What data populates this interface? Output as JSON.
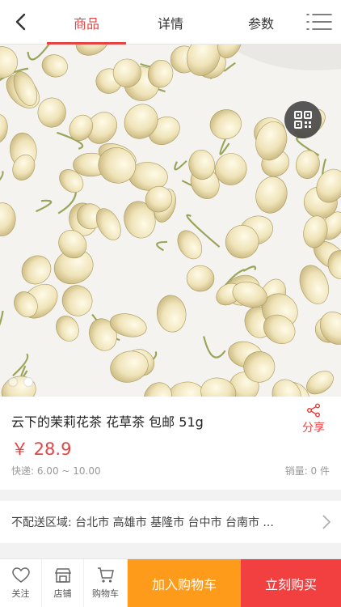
{
  "header": {
    "tabs": [
      {
        "label": "商品",
        "active": true
      },
      {
        "label": "详情",
        "active": false
      },
      {
        "label": "参数",
        "active": false
      }
    ],
    "icons": {
      "back": "back-icon",
      "menu": "menu-icon"
    }
  },
  "hero": {
    "image": "dried-jasmine-flowers",
    "qr_icon": "qr-code-icon",
    "carousel_total": 3,
    "carousel_active_index": 2
  },
  "product": {
    "title": "云下的茉莉花茶 花草茶 包邮 51g",
    "share_label": "分享",
    "price": "￥ 28.9",
    "shipping": "快递: 6.00 ~ 10.00",
    "sales": "销量: 0 件"
  },
  "restriction": {
    "text": "不配送区域: 台北市 高雄市 基隆市 台中市 台南市 ..."
  },
  "bottom": {
    "follow_label": "关注",
    "shop_label": "店铺",
    "cart_label": "购物车",
    "add_to_cart_label": "加入购物车",
    "buy_now_label": "立刻购买"
  },
  "colors": {
    "accent": "#e54444",
    "add_to_cart_bg": "#ff9b1a",
    "buy_now_bg": "#f23f3f"
  }
}
